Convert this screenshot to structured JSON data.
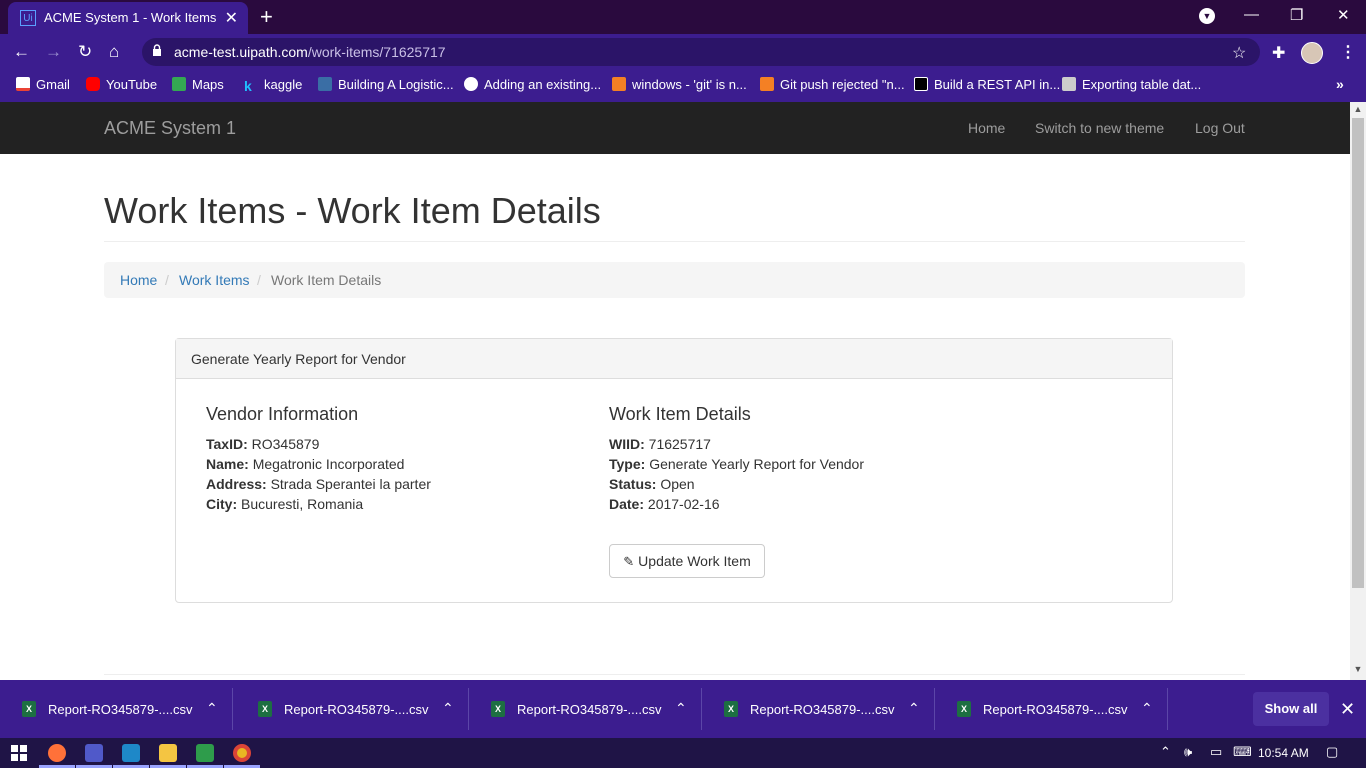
{
  "browser": {
    "tab_title": "ACME System 1 - Work Items",
    "tab_favicon": "Ui",
    "tab_close": "✕",
    "new_tab": "+",
    "url_host": "acme-test.uipath.com",
    "url_path": "/work-items/71625717",
    "bookmarks": [
      {
        "label": "Gmail",
        "color": "#ea4335"
      },
      {
        "label": "YouTube",
        "color": "#ff0000"
      },
      {
        "label": "Maps",
        "color": "#34a853"
      },
      {
        "label": "kaggle",
        "color": "#20beff"
      },
      {
        "label": "Building A Logistic...",
        "color": "#3a6ea5"
      },
      {
        "label": "Adding an existing...",
        "color": "#ffffff"
      },
      {
        "label": "windows - 'git' is n...",
        "color": "#f48024"
      },
      {
        "label": "Git push rejected \"n...",
        "color": "#f48024"
      },
      {
        "label": "Build a REST API in...",
        "color": "#000000"
      },
      {
        "label": "Exporting table dat...",
        "color": "#cccccc"
      }
    ]
  },
  "app": {
    "brand": "ACME System 1",
    "nav": {
      "home": "Home",
      "theme": "Switch to new theme",
      "logout": "Log Out"
    },
    "page_title": "Work Items - Work Item Details",
    "breadcrumb": {
      "home": "Home",
      "work_items": "Work Items",
      "current": "Work Item Details",
      "sep": "/"
    },
    "panel_title": "Generate Yearly Report for Vendor",
    "vendor": {
      "heading": "Vendor Information",
      "taxid_label": "TaxID:",
      "taxid": "RO345879",
      "name_label": "Name:",
      "name": "Megatronic Incorporated",
      "address_label": "Address:",
      "address": "Strada Sperantei la parter",
      "city_label": "City:",
      "city": "Bucuresti, Romania"
    },
    "work_item": {
      "heading": "Work Item Details",
      "wiid_label": "WIID:",
      "wiid": "71625717",
      "type_label": "Type:",
      "type": "Generate Yearly Report for Vendor",
      "status_label": "Status:",
      "status": "Open",
      "date_label": "Date:",
      "date": "2017-02-16"
    },
    "update_button": "Update Work Item"
  },
  "downloads": {
    "items": [
      "Report-RO345879-....csv",
      "Report-RO345879-....csv",
      "Report-RO345879-....csv",
      "Report-RO345879-....csv",
      "Report-RO345879-....csv"
    ],
    "show_all": "Show all"
  },
  "taskbar": {
    "clock": "10:54 AM"
  },
  "colors": {
    "accent": "#3c1d8f",
    "link": "#337ab7",
    "navbar": "#222222"
  }
}
